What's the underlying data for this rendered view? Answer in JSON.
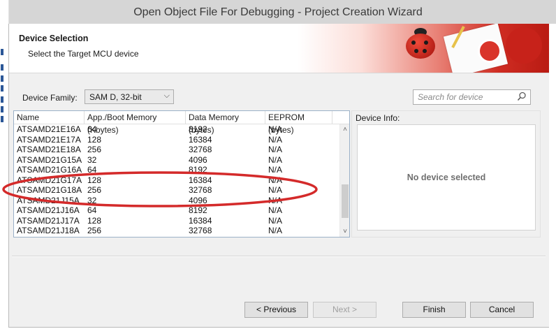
{
  "window": {
    "title": "Open Object File For Debugging  -  Project Creation Wizard"
  },
  "header": {
    "title": "Device Selection",
    "subtitle": "Select the Target MCU device"
  },
  "filters": {
    "family_label": "Device Family:",
    "family_value": "SAM D, 32-bit",
    "search_placeholder": "Search for device"
  },
  "table": {
    "columns": [
      "Name",
      "App./Boot Memory (Kbytes)",
      "Data Memory (bytes)",
      "EEPROM (bytes)"
    ],
    "rows": [
      [
        "ATSAMD21E16A",
        "64",
        "8192",
        "N/A"
      ],
      [
        "ATSAMD21E17A",
        "128",
        "16384",
        "N/A"
      ],
      [
        "ATSAMD21E18A",
        "256",
        "32768",
        "N/A"
      ],
      [
        "ATSAMD21G15A",
        "32",
        "4096",
        "N/A"
      ],
      [
        "ATSAMD21G16A",
        "64",
        "8192",
        "N/A"
      ],
      [
        "ATSAMD21G17A",
        "128",
        "16384",
        "N/A"
      ],
      [
        "ATSAMD21G18A",
        "256",
        "32768",
        "N/A"
      ],
      [
        "ATSAMD21J15A",
        "32",
        "4096",
        "N/A"
      ],
      [
        "ATSAMD21J16A",
        "64",
        "8192",
        "N/A"
      ],
      [
        "ATSAMD21J17A",
        "128",
        "16384",
        "N/A"
      ],
      [
        "ATSAMD21J18A",
        "256",
        "32768",
        "N/A"
      ]
    ]
  },
  "device_info": {
    "label": "Device Info:",
    "empty_text": "No device selected"
  },
  "buttons": {
    "previous": "< Previous",
    "next": "Next >",
    "finish": "Finish",
    "cancel": "Cancel"
  },
  "icons": {
    "search": "magnifier-icon",
    "dropdown": "chevron-down-icon"
  },
  "colors": {
    "annotation": "#d42a2a",
    "banner_red": "#cf2c22"
  }
}
